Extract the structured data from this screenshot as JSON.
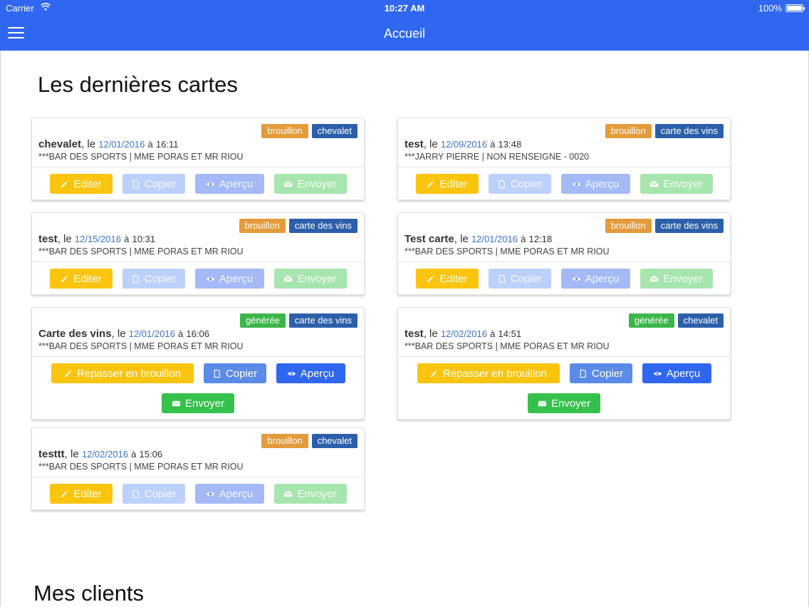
{
  "status": {
    "carrier": "Carrier",
    "time": "10:27 AM",
    "battery": "100%"
  },
  "nav": {
    "title": "Accueil"
  },
  "sections": {
    "recent": "Les dernières cartes",
    "clients": "Mes clients"
  },
  "labels": {
    "le": ", le",
    "a": "à",
    "edit": "Editer",
    "copy": "Copier",
    "view": "Aperçu",
    "send": "Envoyer",
    "repasser": "Repasser en brouillon"
  },
  "colors": {
    "nav": "#2f67f0",
    "edit": "#fbc40f",
    "brouillon": "#e49b3b",
    "generee": "#3cb54a",
    "type": "#2b5faa"
  },
  "cards": [
    {
      "name": "chevalet",
      "date": "12/01/2016",
      "time": "16:11",
      "sub": "***BAR DES SPORTS | MME PORAS ET MR RIOU",
      "status": "brouillon",
      "type": "chevalet"
    },
    {
      "name": "test",
      "date": "12/09/2016",
      "time": "13:48",
      "sub": "***JARRY PIERRE | NON RENSEIGNE - 0020",
      "status": "brouillon",
      "type": "carte des vins"
    },
    {
      "name": "test",
      "date": "12/15/2016",
      "time": "10:31",
      "sub": "***BAR DES SPORTS | MME PORAS ET MR RIOU",
      "status": "brouillon",
      "type": "carte des vins"
    },
    {
      "name": "Test carte",
      "date": "12/01/2016",
      "time": "12:18",
      "sub": "***BAR DES SPORTS | MME PORAS ET MR RIOU",
      "status": "brouillon",
      "type": "carte des vins"
    },
    {
      "name": "Carte des vins",
      "date": "12/01/2016",
      "time": "16:06",
      "sub": "***BAR DES SPORTS | MME PORAS ET MR RIOU",
      "status": "générée",
      "type": "carte des vins"
    },
    {
      "name": "test",
      "date": "12/02/2016",
      "time": "14:51",
      "sub": "***BAR DES SPORTS | MME PORAS ET MR RIOU",
      "status": "générée",
      "type": "chevalet"
    },
    {
      "name": "testtt",
      "date": "12/02/2016",
      "time": "15:06",
      "sub": "***BAR DES SPORTS | MME PORAS ET MR RIOU",
      "status": "brouillon",
      "type": "chevalet"
    }
  ]
}
